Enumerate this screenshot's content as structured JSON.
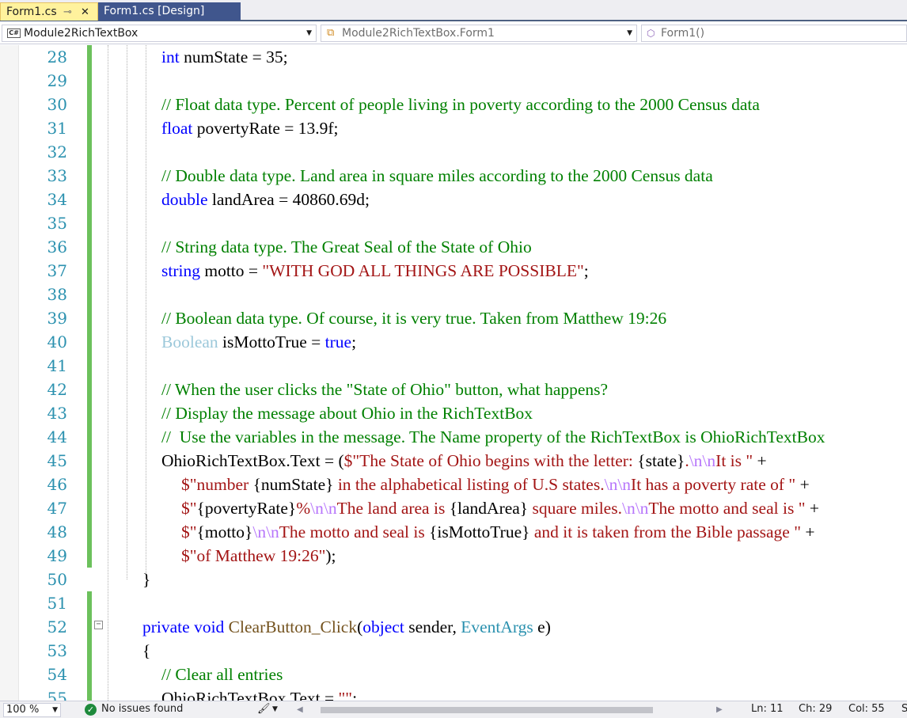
{
  "tabs": [
    {
      "label": "Form1.cs",
      "active": true
    },
    {
      "label": "Form1.cs [Design]",
      "active": false
    }
  ],
  "tab_icons": {
    "pin": "pin-icon",
    "close": "close-icon"
  },
  "navbar": {
    "project_badge": "C#",
    "project": "Module2RichTextBox",
    "class": "Module2RichTextBox.Form1",
    "member": "Form1()"
  },
  "line_numbers": [
    "28",
    "29",
    "30",
    "31",
    "32",
    "33",
    "34",
    "35",
    "36",
    "37",
    "38",
    "39",
    "40",
    "41",
    "42",
    "43",
    "44",
    "45",
    "46",
    "47",
    "48",
    "49",
    "50",
    "51",
    "52",
    "53",
    "54",
    "55"
  ],
  "code": {
    "l28": {
      "kw": "int",
      "rest": " numState = 35;"
    },
    "l30": "// Float data type. Percent of people living in poverty according to the 2000 Census data",
    "l31": {
      "kw": "float",
      "rest": " povertyRate = 13.9f;"
    },
    "l33": "// Double data type. Land area in square miles according to the 2000 Census data",
    "l34": {
      "kw": "double",
      "rest": " landArea = 40860.69d;"
    },
    "l36": "// String data type. The Great Seal of the State of Ohio",
    "l37": {
      "kw": "string",
      "mid": " motto = ",
      "str": "\"WITH GOD ALL THINGS ARE POSSIBLE\"",
      "end": ";"
    },
    "l39": "// Boolean data type. Of course, it is very true. Taken from Matthew 19:26",
    "l40": {
      "ty": "Boolean",
      "mid": " isMottoTrue = ",
      "kw": "true",
      "end": ";"
    },
    "l42": "// When the user clicks the \"State of Ohio\" button, what happens?",
    "l43": "// Display the message about Ohio in the RichTextBox",
    "l44": "//  Use the variables in the message. The Name property of the RichTextBox is OhioRichTextBox",
    "l45": {
      "a": "OhioRichTextBox.Text = (",
      "b": "$\"The State of Ohio begins with the letter: ",
      "c": "{state}",
      "d": ".",
      "e": "\\n\\n",
      "f": "It is \"",
      "g": " +"
    },
    "l46": {
      "a": "$\"number ",
      "b": "{numState}",
      "c": " in the alphabetical listing of U.S states.",
      "d": "\\n\\n",
      "e": "It has a poverty rate of \"",
      "f": " +"
    },
    "l47": {
      "a": "$\"",
      "b": "{povertyRate}",
      "c": "%",
      "d": "\\n\\n",
      "e": "The land area is ",
      "f": "{landArea}",
      "g": " square miles.",
      "h": "\\n\\n",
      "i": "The motto and seal is \"",
      "j": " +"
    },
    "l48": {
      "a": "$\"",
      "b": "{motto}",
      "c": "\\n\\n",
      "d": "The motto and seal is ",
      "e": "{isMottoTrue}",
      "f": " and it is taken from the Bible passage \"",
      "g": " +"
    },
    "l49": {
      "a": "$\"of Matthew 19:26\"",
      "b": ");"
    },
    "l50": "}",
    "l52": {
      "kw": "private void",
      "sp": " ",
      "mt": "ClearButton_Click",
      "p1": "(",
      "kw2": "object",
      "p2": " sender, ",
      "ty": "EventArgs",
      "p3": " e)"
    },
    "l53": "{",
    "l54": "// Clear all entries",
    "l55": {
      "a": "OhioRichTextBox.Text = ",
      "b": "\"\"",
      "c": ";"
    }
  },
  "status": {
    "zoom": "100 %",
    "issues": "No issues found",
    "line": "Ln: 11",
    "char": "Ch: 29",
    "col": "Col: 55",
    "mode": "SPC"
  }
}
